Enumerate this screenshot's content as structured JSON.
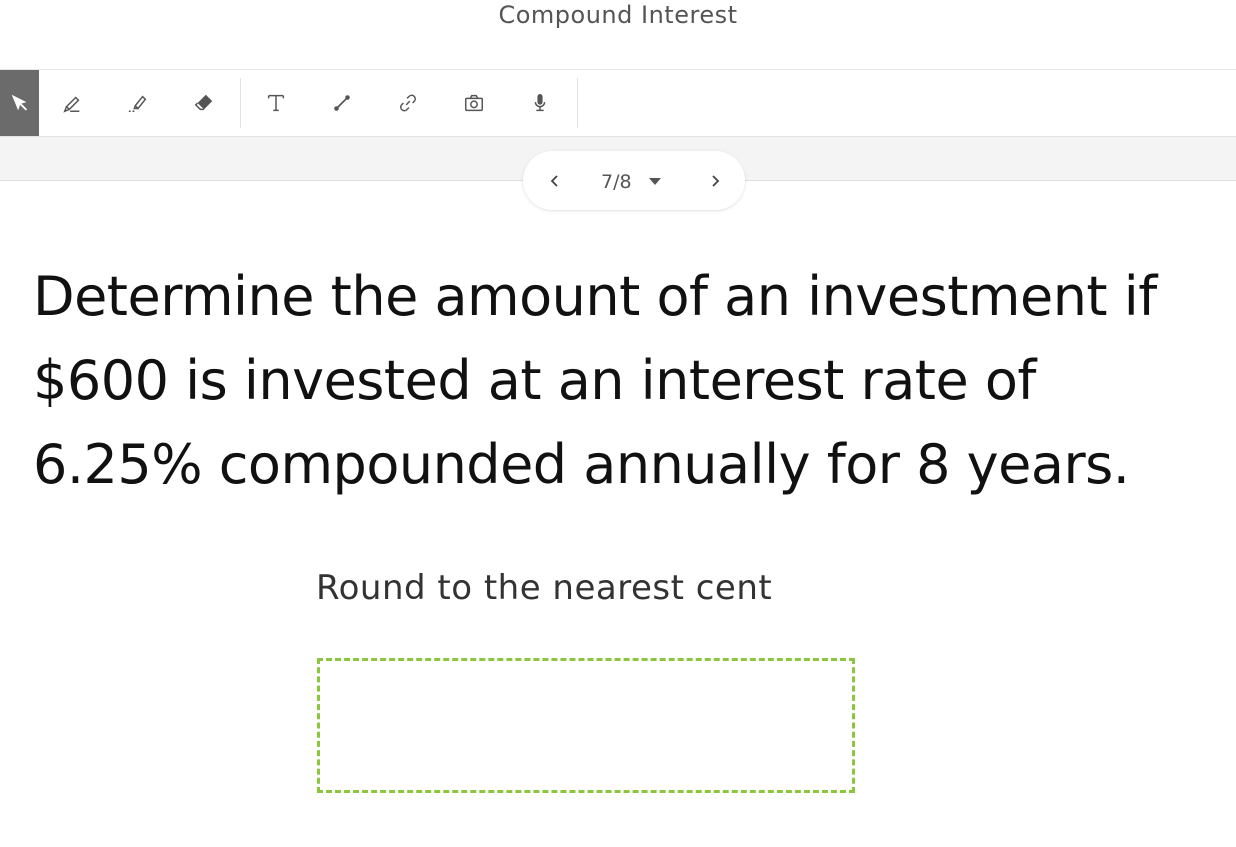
{
  "header": {
    "title": "Compound Interest"
  },
  "toolbar": {
    "tools": [
      {
        "name": "select-tool",
        "icon": "cursor-icon",
        "active": true
      },
      {
        "name": "pen-tool",
        "icon": "pen-icon"
      },
      {
        "name": "highlighter-tool",
        "icon": "highlighter-icon"
      },
      {
        "name": "eraser-tool",
        "icon": "eraser-icon"
      },
      {
        "name": "text-tool",
        "icon": "text-icon"
      },
      {
        "name": "line-tool",
        "icon": "line-icon"
      },
      {
        "name": "link-tool",
        "icon": "link-icon"
      },
      {
        "name": "camera-tool",
        "icon": "camera-icon"
      },
      {
        "name": "microphone-tool",
        "icon": "microphone-icon"
      }
    ]
  },
  "pager": {
    "label": "7/8"
  },
  "slide": {
    "question_lines": [
      "Determine the amount of an investment if",
      "$600 is invested at an interest rate of",
      "6.25% compounded annually for 8 years."
    ],
    "instruction": "Round to the nearest cent"
  },
  "colors": {
    "answer_border": "#8cc63f",
    "active_tool_bg": "#6b6b6b"
  }
}
